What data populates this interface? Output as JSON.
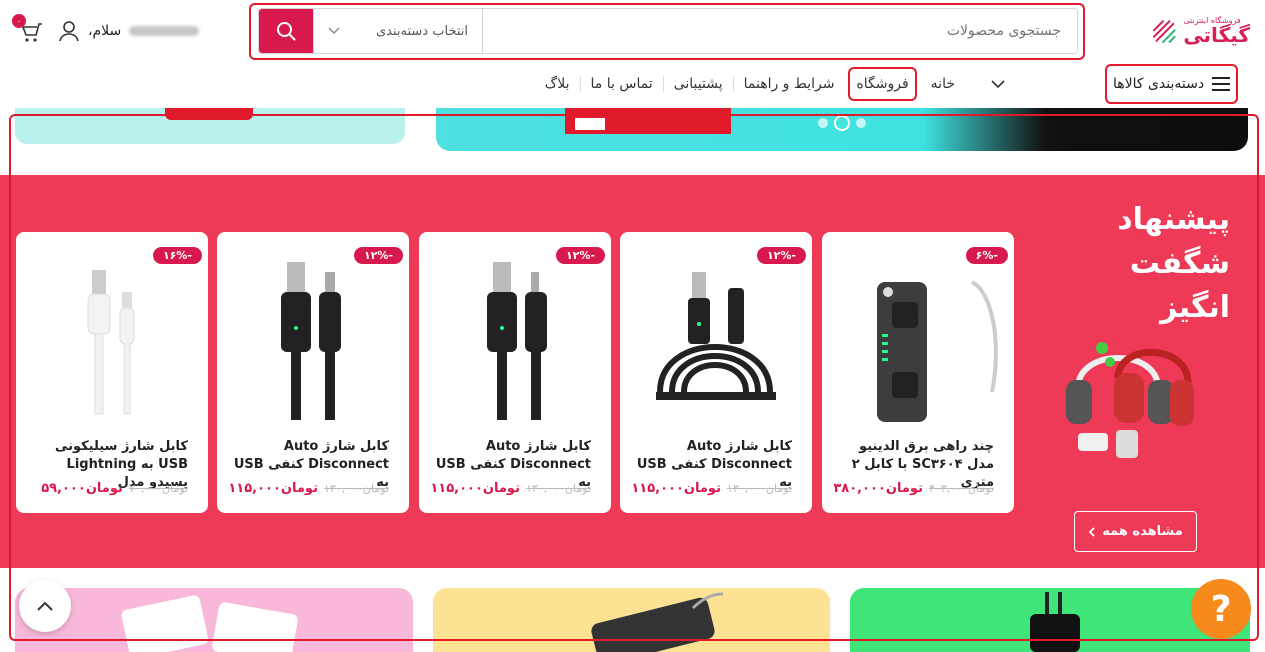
{
  "header": {
    "logo_small": "فروشگاه اینترنتی",
    "logo_big": "گیگاتی",
    "search_placeholder": "جستجوی محصولات",
    "category_select": "انتخاب دسته‌بندی",
    "greeting": "سلام،",
    "cart_count": "۰"
  },
  "nav": {
    "categories_label": "دسته‌بندی کالاها",
    "items": [
      "خانه",
      "فروشگاه",
      "شرایط و راهنما",
      "پشتیبانی",
      "تماس با ما",
      "بلاگ"
    ]
  },
  "amazing": {
    "title_line1": "پیشنهاد",
    "title_line2": "شگفت",
    "title_line3": "انگیز",
    "see_all": "مشاهده همه"
  },
  "products": [
    {
      "discount": "-۶%",
      "title": "چند راهی برق الدینیو مدل SC۳۶۰۴ با کابل ۲ متری",
      "price": "۳۸۰,۰۰۰",
      "old_price": "۴۰۳,۰۰۰",
      "currency": "تومان",
      "image": "power-strip"
    },
    {
      "discount": "-۱۲%",
      "title": "کابل شارژ Auto Disconnect کنفی USB به",
      "price": "۱۱۵,۰۰۰",
      "old_price": "۱۳۰,۰۰۰",
      "currency": "تومان",
      "image": "cable-lightning"
    },
    {
      "discount": "-۱۲%",
      "title": "کابل شارژ Auto Disconnect کنفی USB به",
      "price": "۱۱۵,۰۰۰",
      "old_price": "۱۳۰,۰۰۰",
      "currency": "تومان",
      "image": "cable-micro"
    },
    {
      "discount": "-۱۲%",
      "title": "کابل شارژ Auto Disconnect کنفی USB به",
      "price": "۱۱۵,۰۰۰",
      "old_price": "۱۳۰,۰۰۰",
      "currency": "تومان",
      "image": "cable-typec"
    },
    {
      "discount": "-۱۶%",
      "title": "کابل شارژ سیلیکونی USB به Lightning یسیدو مدل",
      "price": "۵۹,۰۰۰",
      "old_price": "۷۰,۰۰۰",
      "currency": "تومان",
      "image": "cable-white"
    }
  ],
  "colors": {
    "accent": "#d8194d",
    "section_bg": "#ee3a57",
    "help": "#f78a1d"
  }
}
